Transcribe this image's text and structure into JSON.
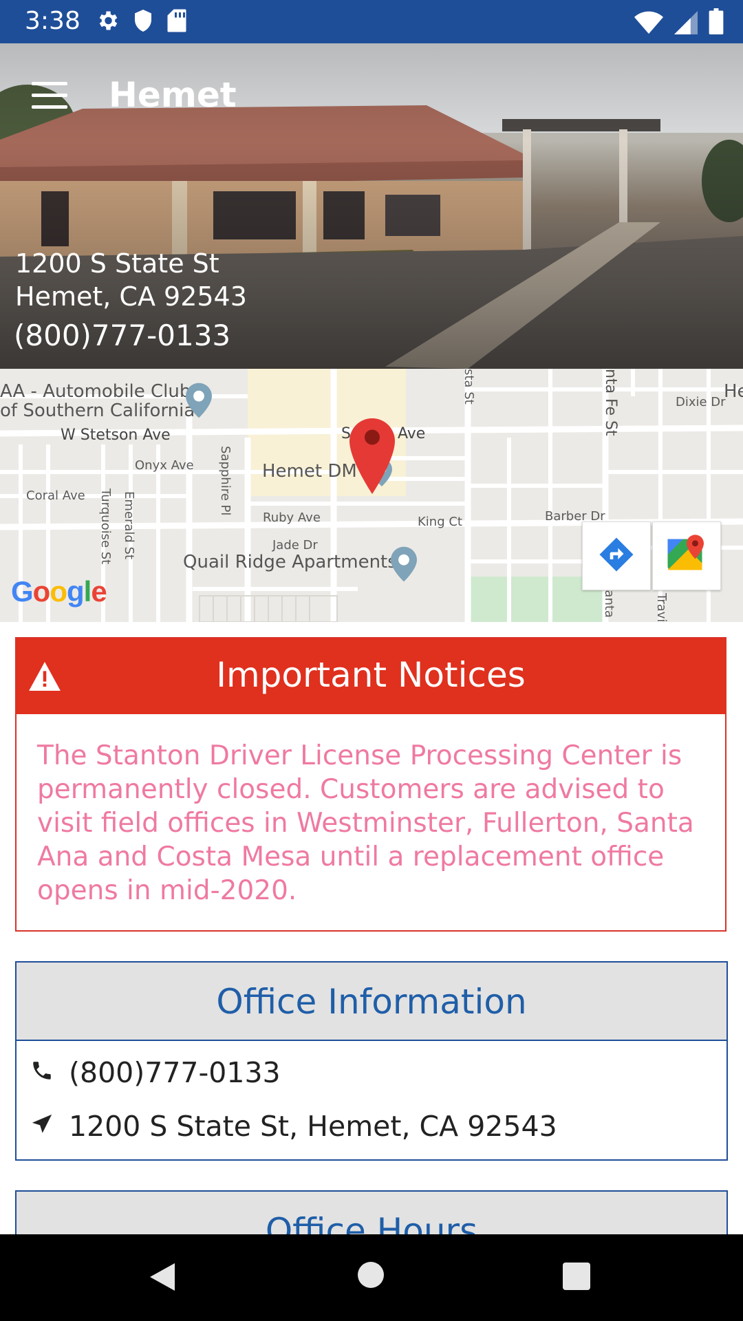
{
  "status_bar": {
    "time": "3:38",
    "left_icons": [
      "gear-icon",
      "shield-icon",
      "sd-card-icon"
    ],
    "right_icons": [
      "wifi-icon",
      "signal-icon",
      "battery-icon"
    ],
    "bg_color": "#1f4e99"
  },
  "hero": {
    "title": "Hemet",
    "address_line1": "1200 S State St",
    "address_line2": "Hemet, CA 92543",
    "phone": "(800)777-0133",
    "menu_icon": "hamburger-menu-icon"
  },
  "map": {
    "labels": {
      "aaa_line1": "AA - Automobile Club",
      "aaa_line2": "of Southern California",
      "w_stetson": "W Stetson Ave",
      "stetson_ave": "Ave",
      "stetson_s": "S",
      "onyx": "Onyx Ave",
      "coral": "Coral Ave",
      "ruby": "Ruby Ave",
      "jade": "Jade Dr",
      "king": "King Ct",
      "barber": "Barber Dr",
      "dixie": "Dixie Dr",
      "hemet_dmv": "Hemet DMV",
      "quail_ridge": "Quail Ridge Apartments",
      "sapphire": "Sapphire Pl",
      "turquoise": "Turquoise St",
      "emerald": "Emerald St",
      "santa_fe": "nta Fe St",
      "state_st": "sta St",
      "santa_fe_lower": "Santa F",
      "travis": "Travis",
      "he": "He"
    },
    "google_logo": [
      "G",
      "o",
      "o",
      "g",
      "l",
      "e"
    ],
    "directions_button": "directions-icon",
    "maps_button": "google-maps-icon"
  },
  "notices": {
    "title": "Important Notices",
    "body": "The Stanton Driver License Processing Center is permanently closed. Customers are advised to visit field offices in Westminster, Fullerton, Santa Ana and Costa Mesa until a replacement office opens in mid-2020.",
    "header_color": "#e0301e",
    "text_color": "#ef7aa0"
  },
  "office_info": {
    "title": "Office Information",
    "phone": "(800)777-0133",
    "address": "1200 S State St, Hemet, CA 92543",
    "accent_color": "#1f4e99"
  },
  "office_hours": {
    "title": "Office Hours"
  },
  "nav_bar": {
    "buttons": [
      "back-icon",
      "home-icon",
      "recents-icon"
    ]
  }
}
